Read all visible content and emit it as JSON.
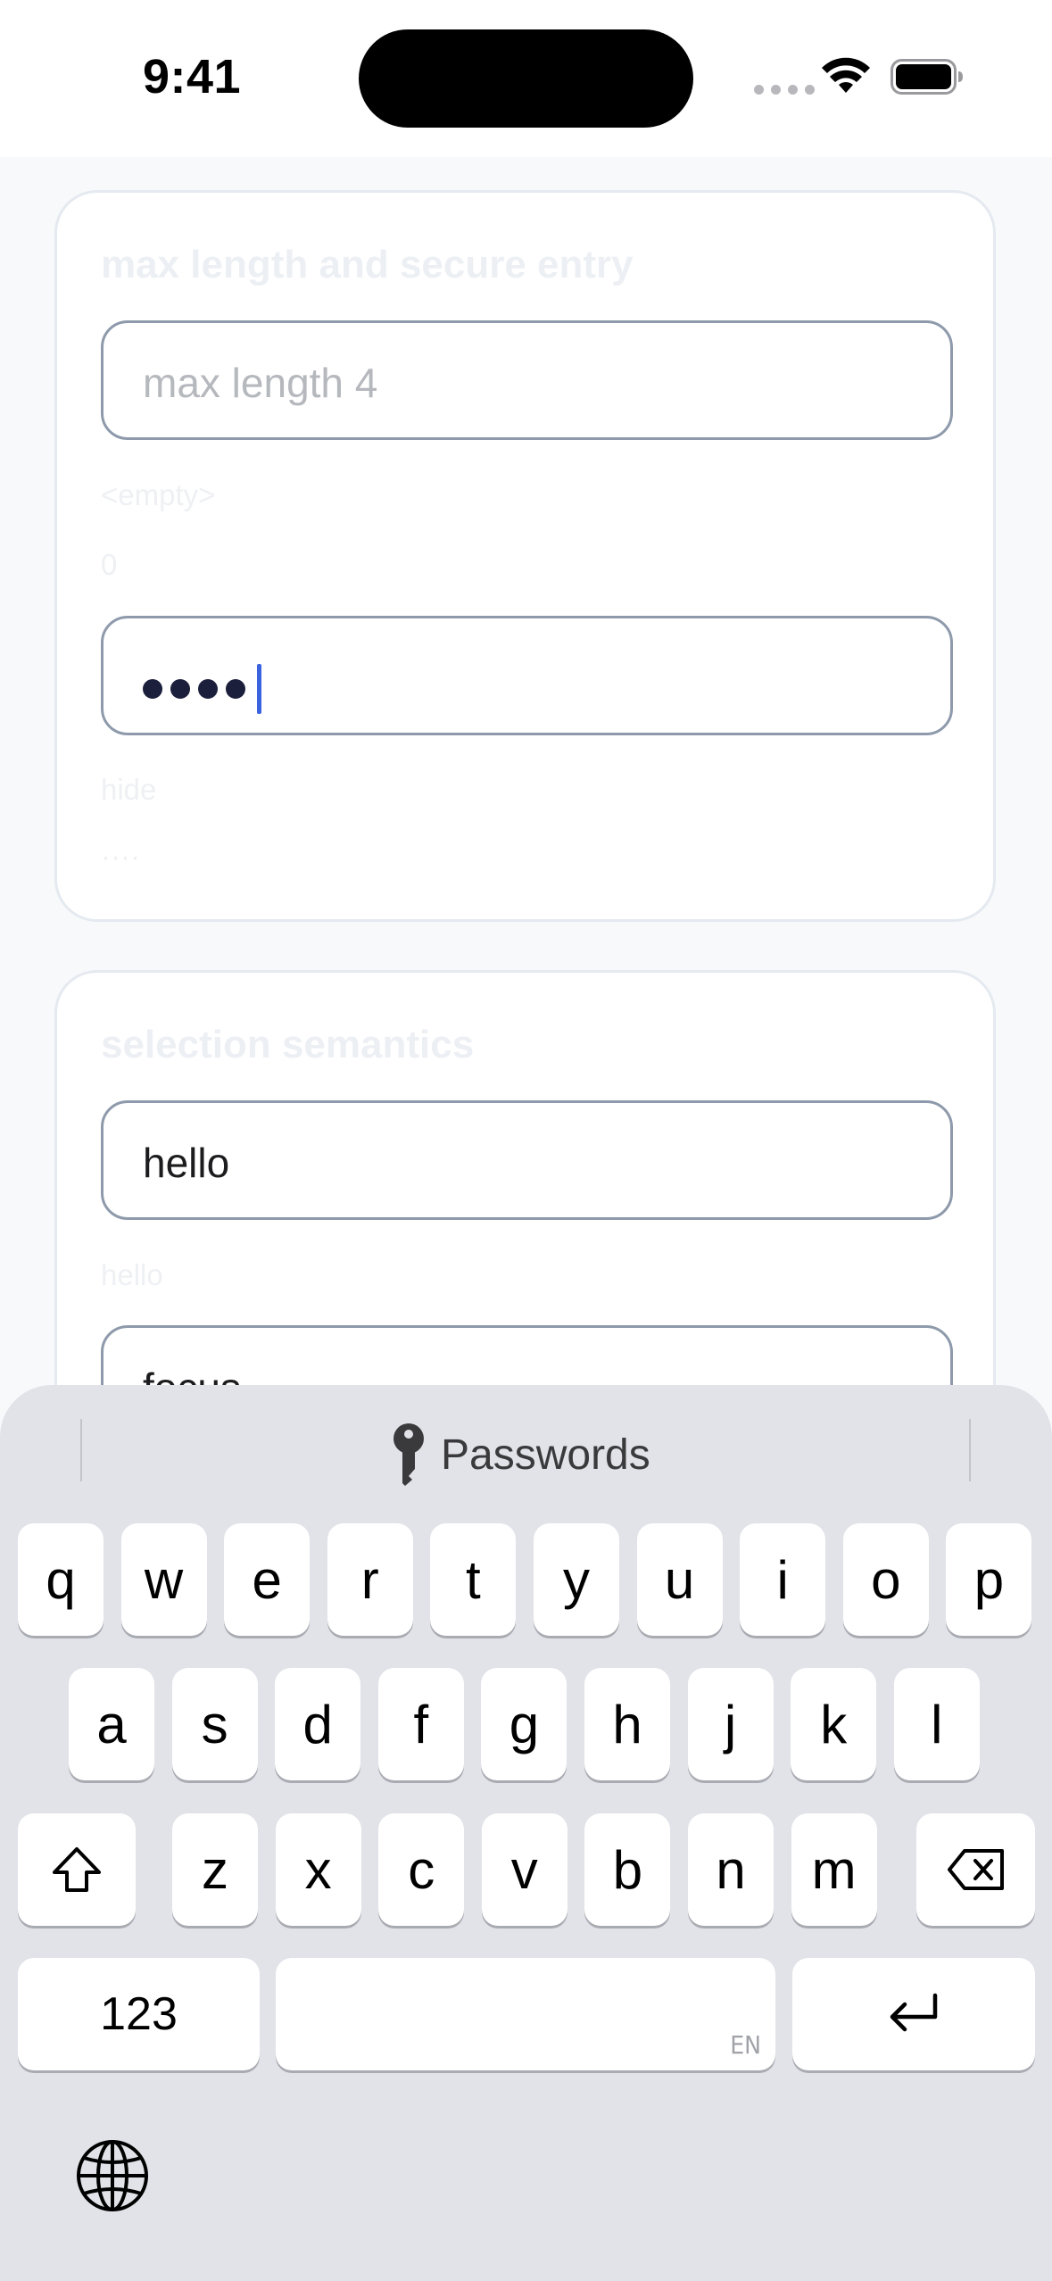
{
  "status_bar": {
    "time": "9:41"
  },
  "card1": {
    "title": "max length and secure entry",
    "field1_placeholder": "max length 4",
    "field1_value_label": "<empty>",
    "field1_count": "0",
    "field2_masked_count": 4,
    "field2_label": "hide",
    "field2_value_echo": "····"
  },
  "card2": {
    "title": "selection semantics",
    "field1_value": "hello",
    "field1_echo": "hello",
    "field2_value": "focus"
  },
  "keyboard": {
    "suggestion_label": "Passwords",
    "row1": [
      "q",
      "w",
      "e",
      "r",
      "t",
      "y",
      "u",
      "i",
      "o",
      "p"
    ],
    "row2": [
      "a",
      "s",
      "d",
      "f",
      "g",
      "h",
      "j",
      "k",
      "l"
    ],
    "row3": [
      "z",
      "x",
      "c",
      "v",
      "b",
      "n",
      "m"
    ],
    "numbers_label": "123",
    "space_lang": "EN",
    "icons": {
      "shift": "shift-icon",
      "delete": "delete-icon",
      "return": "return-icon",
      "globe": "globe-icon",
      "key": "key-icon"
    }
  },
  "colors": {
    "caret": "#3a63e0",
    "field_border": "#8e9aab",
    "keyboard_bg": "#e1e3e8"
  }
}
